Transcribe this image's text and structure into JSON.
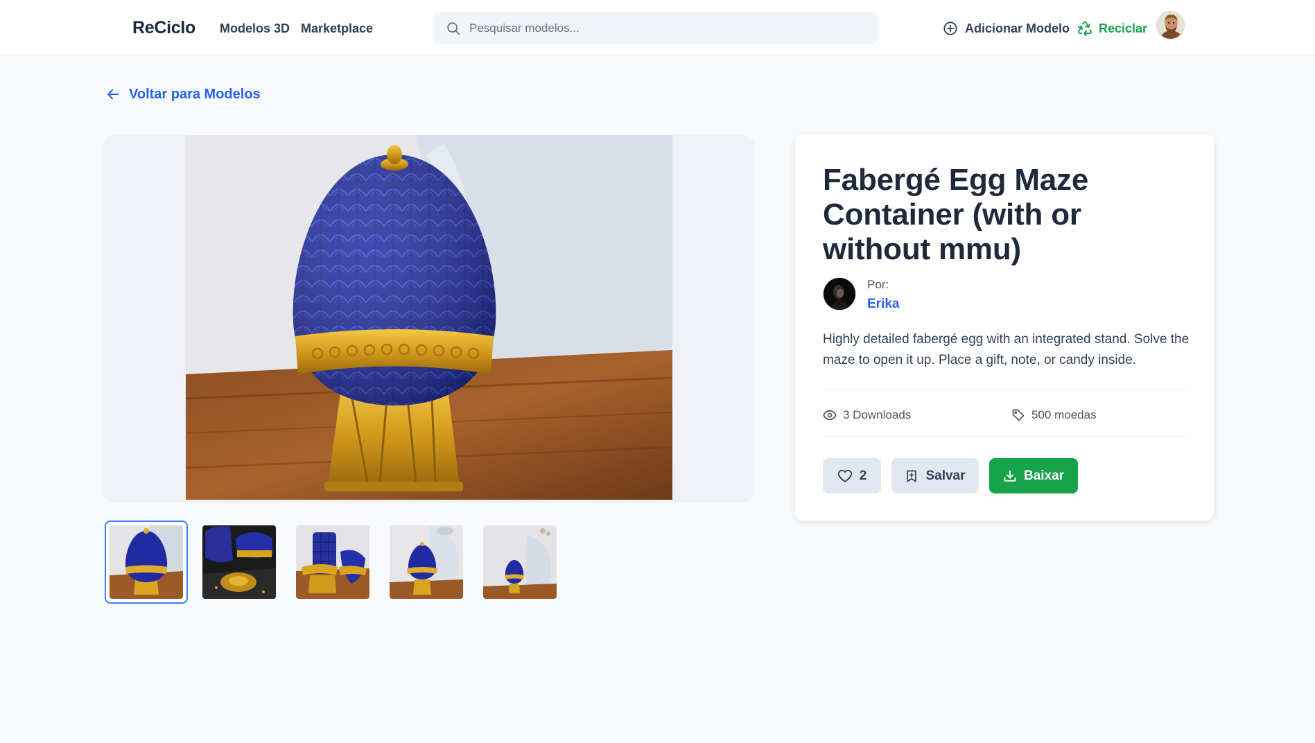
{
  "header": {
    "brand": "ReCiclo",
    "nav": [
      "Modelos 3D",
      "Marketplace"
    ],
    "search_placeholder": "Pesquisar modelos...",
    "add_model": "Adicionar Modelo",
    "recycle": "Reciclar"
  },
  "back_link": "Voltar para Modelos",
  "model": {
    "title": "Fabergé Egg Maze Container (with or without mmu)",
    "by_label": "Por:",
    "author": "Erika",
    "description": "Highly detailed fabergé egg with an integrated stand. Solve the maze to open it up. Place a gift, note, or candy inside.",
    "downloads": "3 Downloads",
    "price": "500 moedas",
    "likes": "2",
    "save_label": "Salvar",
    "download_label": "Baixar"
  },
  "gallery": {
    "thumbnail_count": 5,
    "selected_index": 0
  },
  "colors": {
    "accent": "#2563eb",
    "success": "#16a34a",
    "egg_blue": "#1f2aa3",
    "gold": "#d9a520"
  }
}
